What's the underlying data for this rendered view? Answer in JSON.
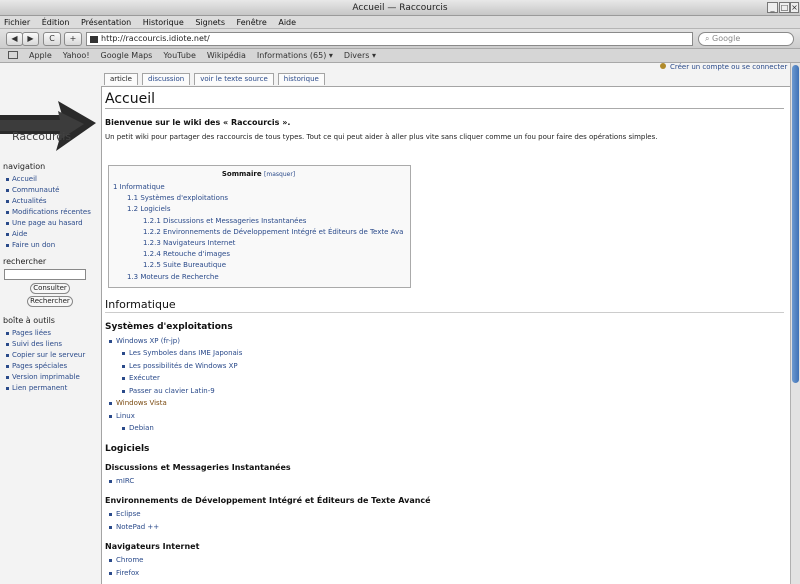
{
  "window": {
    "title": "Accueil — Raccourcis"
  },
  "menu": [
    "Fichier",
    "Édition",
    "Présentation",
    "Historique",
    "Signets",
    "Fenêtre",
    "Aide"
  ],
  "toolbar": {
    "back_label": "◀",
    "forward_label": "▶",
    "reload_label": "C",
    "add_label": "+",
    "url": "http://raccourcis.idiote.net/",
    "search_placeholder": "Google"
  },
  "bookmarks": [
    "Apple",
    "Yahoo!",
    "Google Maps",
    "YouTube",
    "Wikipédia",
    "Informations (65) ▾",
    "Divers ▾"
  ],
  "user_link": "Créer un compte ou se connecter",
  "tabs": [
    "article",
    "discussion",
    "voir le texte source",
    "historique"
  ],
  "logo_text": "Raccourcis",
  "sidebar": {
    "navigation_title": "navigation",
    "navigation": [
      "Accueil",
      "Communauté",
      "Actualités",
      "Modifications récentes",
      "Une page au hasard",
      "Aide",
      "Faire un don"
    ],
    "search_title": "rechercher",
    "search_go": "Consulter",
    "search_button": "Rechercher",
    "tools_title": "boîte à outils",
    "tools": [
      "Pages liées",
      "Suivi des liens",
      "Copier sur le serveur",
      "Pages spéciales",
      "Version imprimable",
      "Lien permanent"
    ]
  },
  "page": {
    "title": "Accueil",
    "welcome": "Bienvenue sur le wiki des « Raccourcis ».",
    "intro": "Un petit wiki pour partager des raccourcis de tous types. Tout ce qui peut aider à aller plus vite sans cliquer comme un fou pour faire des opérations simples."
  },
  "toc": {
    "title": "Sommaire",
    "hide": "[masquer]",
    "items": [
      {
        "level": 1,
        "text": "1 Informatique"
      },
      {
        "level": 2,
        "text": "1.1 Systèmes d'exploitations"
      },
      {
        "level": 2,
        "text": "1.2 Logiciels"
      },
      {
        "level": 3,
        "text": "1.2.1 Discussions et Messageries Instantanées"
      },
      {
        "level": 3,
        "text": "1.2.2 Environnements de Développement Intégré et Éditeurs de Texte Avancé"
      },
      {
        "level": 3,
        "text": "1.2.3 Navigateurs Internet"
      },
      {
        "level": 3,
        "text": "1.2.4 Retouche d'images"
      },
      {
        "level": 3,
        "text": "1.2.5 Suite Bureautique"
      },
      {
        "level": 2,
        "text": "1.3 Moteurs de Recherche"
      }
    ]
  },
  "sections": {
    "informatique": "Informatique",
    "systemes": "Systèmes d'exploitations",
    "systemes_list": [
      {
        "text": "Windows XP (fr-jp)",
        "sub": false,
        "visited": false
      },
      {
        "text": "Les Symboles dans IME Japonais",
        "sub": true,
        "visited": false
      },
      {
        "text": "Les possibilités de Windows XP",
        "sub": true,
        "visited": false
      },
      {
        "text": "Exécuter",
        "sub": true,
        "visited": false
      },
      {
        "text": "Passer au clavier Latin-9",
        "sub": true,
        "visited": false
      },
      {
        "text": "Windows Vista",
        "sub": false,
        "visited": true
      },
      {
        "text": "Linux",
        "sub": false,
        "visited": false
      },
      {
        "text": "Debian",
        "sub": true,
        "visited": false
      }
    ],
    "logiciels": "Logiciels",
    "discussions": "Discussions et Messageries Instantanées",
    "discussions_list": [
      "mIRC"
    ],
    "environnements": "Environnements de Développement Intégré et Éditeurs de Texte Avancé",
    "environnements_list": [
      "Eclipse",
      "NotePad ++"
    ],
    "navigateurs": "Navigateurs Internet",
    "navigateurs_list": [
      "Chrome",
      "Firefox"
    ]
  }
}
